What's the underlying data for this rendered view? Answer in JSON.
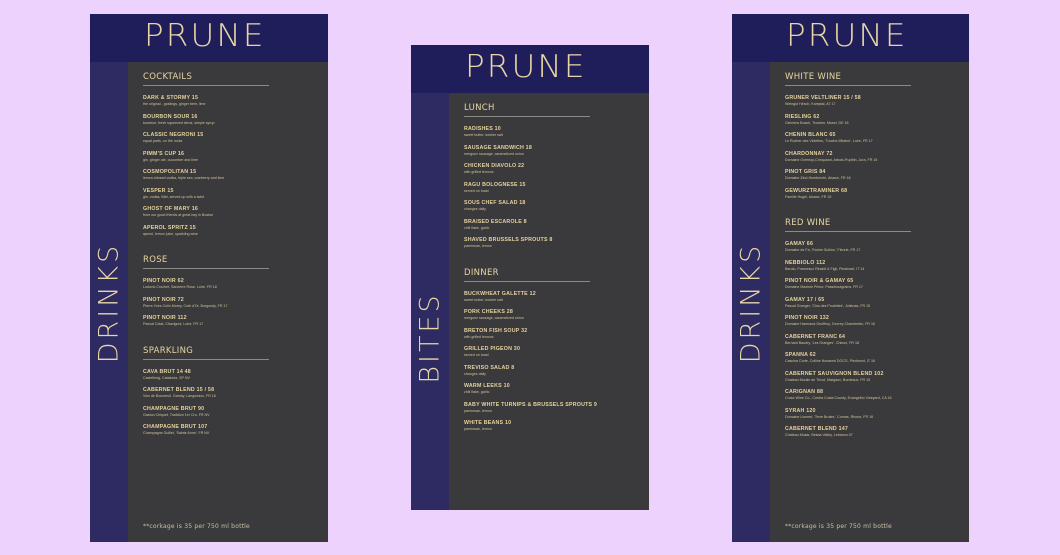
{
  "menus": [
    {
      "brand": "PRUNE",
      "side_title": "DRINKS",
      "footnote": "**corkage is 35 per 750 ml bottle",
      "sections": [
        {
          "title": "COCKTAILS",
          "items": [
            {
              "name": "DARK & STORMY 15",
              "desc": "the original - goslings, ginger beer, lime"
            },
            {
              "name": "BOURBON SOUR 16",
              "desc": "bourbon, fresh squeezed citrus, simple syrup"
            },
            {
              "name": "CLASSIC NEGRONI 15",
              "desc": "equal parts, on the rocks"
            },
            {
              "name": "PIMM'S CUP 16",
              "desc": "gin, ginger ale, cucumber and lime"
            },
            {
              "name": "COSMOPOLITAN 15",
              "desc": "lemon-infused vodka, triple sec, cranberry and lime"
            },
            {
              "name": "VESPER 15",
              "desc": "gin, vodka, lillet, served up with a twist"
            },
            {
              "name": "GHOST OF MARY 16",
              "desc": "from our good friends at great bay in Boston"
            },
            {
              "name": "APEROL SPRITZ 15",
              "desc": "aperol, lemon juice, sparkling wine"
            }
          ]
        },
        {
          "title": "ROSE",
          "items": [
            {
              "name": "PINOT NOIR 62",
              "desc": "Ludovic Crochet, Sancerre Rose, Loire, FR 18"
            },
            {
              "name": "PINOT NOIR 72",
              "desc": "Pierre-Yves Colin Morey, Cote d'Or, Burgundy, FR 17"
            },
            {
              "name": "PINOT NOIR 112",
              "desc": "Pascal Cotat, Chavignol, Loire, FR 17"
            }
          ]
        },
        {
          "title": "SPARKLING",
          "items": [
            {
              "name": "CAVA BRUT 14 48",
              "desc": "Castellroig, Catalonia, SP NV"
            },
            {
              "name": "CABERNET BLEND 15 / 58",
              "desc": "Vins de Bouvreuil, Gamay, Languedoc, FR 18"
            },
            {
              "name": "CHAMPAGNE BRUT 90",
              "desc": "Gaston Chiquet, Tradition 1er Cru, FR NV"
            },
            {
              "name": "CHAMPAGNE BRUT 107",
              "desc": "Champagne Guillet, 'Sainte Anne', FR NV"
            }
          ]
        }
      ]
    },
    {
      "brand": "PRUNE",
      "side_title": "BITES",
      "footnote": "",
      "sections": [
        {
          "title": "LUNCH",
          "items": [
            {
              "name": "RADISHES 10",
              "desc": "sweet butter, kosher salt"
            },
            {
              "name": "SAUSAGE SANDWICH 18",
              "desc": "merguez sausage, caramelized onion"
            },
            {
              "name": "CHICKEN DIAVOLO 22",
              "desc": "with grilled lemons"
            },
            {
              "name": "RAGU BOLOGNESE 15",
              "desc": "served on toast"
            },
            {
              "name": "SOUS CHEF SALAD 18",
              "desc": "changes daily"
            },
            {
              "name": "BRAISED ESCAROLE 8",
              "desc": "chili flake, garlic"
            },
            {
              "name": "SHAVED BRUSSELS SPROUTS 8",
              "desc": "parmesan, lemon"
            }
          ]
        },
        {
          "title": "DINNER",
          "items": [
            {
              "name": "BUCKWHEAT GALETTE 12",
              "desc": "sweet butter, kosher salt"
            },
            {
              "name": "PORK CHEEKS 28",
              "desc": "merguez sausage, caramelized onion"
            },
            {
              "name": "BRETON FISH SOUP 32",
              "desc": "with grilled lemons"
            },
            {
              "name": "GRILLED PIGEON 30",
              "desc": "served on toast"
            },
            {
              "name": "TREVISO SALAD 8",
              "desc": "changes daily"
            },
            {
              "name": "WARM LEEKS 10",
              "desc": "chili flake, garlic"
            },
            {
              "name": "BABY WHITE TURNIPS & BRUSSELS SPROUTS 9",
              "desc": "parmesan, lemon"
            },
            {
              "name": "WHITE BEANS 10",
              "desc": "parmesan, lemon"
            }
          ]
        }
      ]
    },
    {
      "brand": "PRUNE",
      "side_title": "DRINKS",
      "footnote": "**corkage is 35 per 750 ml bottle",
      "sections": [
        {
          "title": "WHITE WINE",
          "items": [
            {
              "name": "GRUNER VELTLINER 15 / 58",
              "desc": "Weingut Hirsch, Kamptal, AT 17"
            },
            {
              "name": "RIESLING 62",
              "desc": "Clemens Busch, Trocken, Mosel, DE 18"
            },
            {
              "name": "CHENIN BLANC 65",
              "desc": "Le Rocher des Violettes, 'Touche-Mitaine', Loire, FR 17"
            },
            {
              "name": "CHARDONNAY 72",
              "desc": "Domaine Overnoy-Crinquand, Arbois-Pupillin, Jura, FR 15"
            },
            {
              "name": "PINOT GRIS 84",
              "desc": "Domaine Zind-Humbrecht, Alsace, FR 18"
            },
            {
              "name": "GEWURZTRAMINER 68",
              "desc": "Famille Hugel, Alsace, FR 15"
            }
          ]
        },
        {
          "title": "RED WINE",
          "items": [
            {
              "name": "GAMAY 66",
              "desc": "Domaine de Fa, 'Roche Guillon,' Fleurie, FR 17"
            },
            {
              "name": "NEBBIOLO 112",
              "desc": "Barolo, Francesco Rinaldi & Figli, Piedmont, IT 14"
            },
            {
              "name": "PINOT NOIR & GAMAY 65",
              "desc": "Domaine Maxime Prieur, Passetoutgrains, FR 17"
            },
            {
              "name": "GAMAY 17 / 65",
              "desc": "Pascal Granger, 'Clos des Poulettes', Julienas, FR 15"
            },
            {
              "name": "PINOT NOIR 132",
              "desc": "Domaine Harmand-Geoffroy, Gevrey-Chambertin, FR 16"
            },
            {
              "name": "CABERNET FRANC 64",
              "desc": "Bernard Baudry, 'Les Granges', Chinon, FR 18"
            },
            {
              "name": "SPANNA 62",
              "desc": "Cascina Corte, Colline Novaresi DOCG, Piedmont, IT 16"
            },
            {
              "name": "CABERNET SAUVIGNON BLEND 102",
              "desc": "Chateau Moulin de Tricot, Margaux, Bordeaux, FR 15"
            },
            {
              "name": "CARIGNAN 88",
              "desc": "Cruse Wine Co., Contra Costa County, Evangelho Vineyard, CA 18"
            },
            {
              "name": "SYRAH 120",
              "desc": "Domaine Lionnet, 'Terre Brulee,' Cornas, Rhone, FR 16"
            },
            {
              "name": "CABERNET BLEND 147",
              "desc": "Chateau Musar, Bekaa Valley, Lebanon 07"
            }
          ]
        }
      ]
    }
  ]
}
